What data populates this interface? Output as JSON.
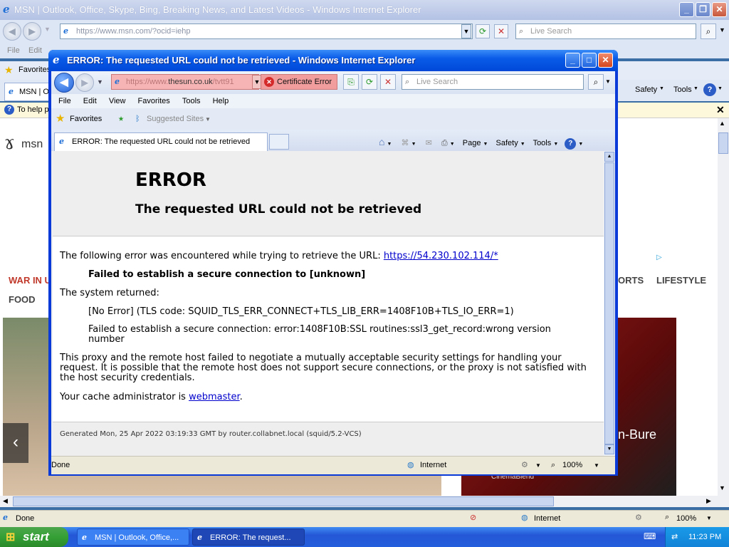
{
  "bg_window": {
    "title": "MSN | Outlook, Office, Skype, Bing, Breaking News, and Latest Videos - Windows Internet Explorer",
    "address": "https://www.msn.com/?ocid=iehp",
    "search_placeholder": "Live Search",
    "menu": [
      "File",
      "Edit"
    ],
    "favorites_label": "Favorites",
    "tab_label": "MSN | O",
    "info_text": "To help p",
    "msn_label": "msn",
    "nav_items": [
      "WAR IN U",
      "FOOD",
      "ORTS",
      "LIFESTYLE"
    ],
    "hero_text": "n-Bure",
    "promo_text": "CinemaBlend",
    "right_tools": [
      "Safety",
      "Tools"
    ],
    "status_done": "Done",
    "status_zone": "Internet",
    "status_zoom": "100%"
  },
  "popup": {
    "title": "ERROR: The requested URL could not be retrieved - Windows Internet Explorer",
    "address_prefix": "https://www.",
    "address_domain": "thesun.co.uk",
    "address_suffix": "/tvtt91",
    "cert_error": "Certificate Error",
    "search_placeholder": "Live Search",
    "menu": [
      "File",
      "Edit",
      "View",
      "Favorites",
      "Tools",
      "Help"
    ],
    "favorites_label": "Favorites",
    "suggested_sites": "Suggested Sites",
    "tab_label": "ERROR: The requested URL could not be retrieved",
    "tools": {
      "page": "Page",
      "safety": "Safety",
      "tools": "Tools"
    },
    "status_done": "Done",
    "status_zone": "Internet",
    "status_zoom": "100%"
  },
  "error_page": {
    "heading": "ERROR",
    "subheading": "The requested URL could not be retrieved",
    "intro": "The following error was encountered while trying to retrieve the URL:",
    "url": "https://54.230.102.114/*",
    "failed": "Failed to establish a secure connection to [unknown]",
    "system_returned": "The system returned:",
    "no_error": "[No Error] (TLS code: SQUID_TLS_ERR_CONNECT+TLS_LIB_ERR=1408F10B+TLS_IO_ERR=1)",
    "ssl_detail": "Failed to establish a secure connection: error:1408F10B:SSL routines:ssl3_get_record:wrong version number",
    "explanation": "This proxy and the remote host failed to negotiate a mutually acceptable security settings for handling your request. It is possible that the remote host does not support secure connections, or the proxy is not satisfied with the host security credentials.",
    "admin_prefix": "Your cache administrator is ",
    "admin_link": "webmaster",
    "admin_suffix": ".",
    "generated": "Generated Mon, 25 Apr 2022 03:19:33 GMT by router.collabnet.local (squid/5.2-VCS)"
  },
  "taskbar": {
    "start": "start",
    "buttons": [
      "MSN | Outlook, Office,...",
      "ERROR: The request..."
    ],
    "clock": "11:23 PM"
  },
  "colors": {
    "xp_blue": "#0a3bd8",
    "cert_error_bg": "#f19d9d",
    "msn_red": "#c0392b",
    "link": "#0000cc"
  }
}
